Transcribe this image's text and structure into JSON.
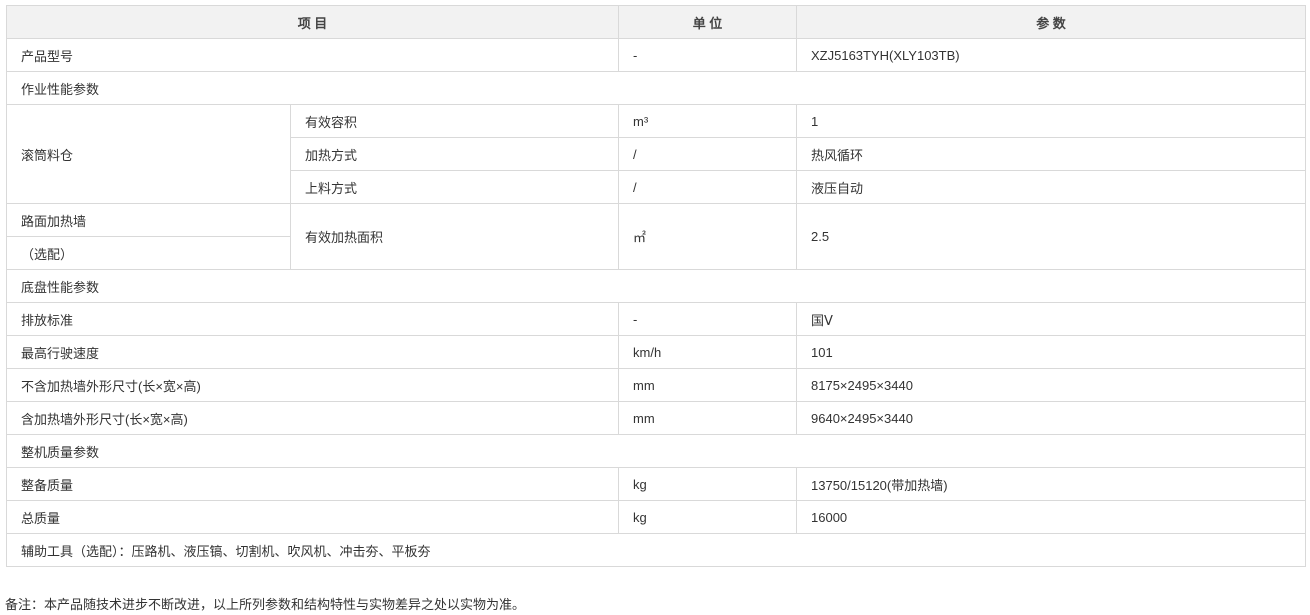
{
  "header": {
    "item": "项 目",
    "unit": "单 位",
    "param": "参 数"
  },
  "rows": {
    "model": {
      "label": "产品型号",
      "unit": "-",
      "value": "XZJ5163TYH(XLY103TB)"
    },
    "work_section": "作业性能参数",
    "drum": {
      "label": "滚筒料仓",
      "volume": {
        "label": "有效容积",
        "unit": "m³",
        "value": "1"
      },
      "heating": {
        "label": "加热方式",
        "unit": "/",
        "value": "热风循环"
      },
      "loading": {
        "label": "上料方式",
        "unit": "/",
        "value": "液压自动"
      }
    },
    "wall": {
      "label": "路面加热墙",
      "label2": "（选配）",
      "sub_label": "有效加热面积",
      "unit": "㎡",
      "value": "2.5"
    },
    "chassis_section": "底盘性能参数",
    "emission": {
      "label": "排放标准",
      "unit": "-",
      "value": "国Ⅴ"
    },
    "speed": {
      "label": "最高行驶速度",
      "unit": "km/h",
      "value": "101"
    },
    "dim_no_wall": {
      "label": "不含加热墙外形尺寸(长×宽×高)",
      "unit": "mm",
      "value": "8175×2495×3440"
    },
    "dim_with_wall": {
      "label": "含加热墙外形尺寸(长×宽×高)",
      "unit": "mm",
      "value": "9640×2495×3440"
    },
    "mass_section": "整机质量参数",
    "curb_mass": {
      "label": "整备质量",
      "unit": "kg",
      "value": "13750/15120(带加热墙)"
    },
    "total_mass": {
      "label": "总质量",
      "unit": "kg",
      "value": "16000"
    },
    "tools": "辅助工具（选配）：压路机、液压镐、切割机、吹风机、冲击夯、平板夯"
  },
  "note": "备注：本产品随技术进步不断改进，以上所列参数和结构特性与实物差异之处以实物为准。"
}
